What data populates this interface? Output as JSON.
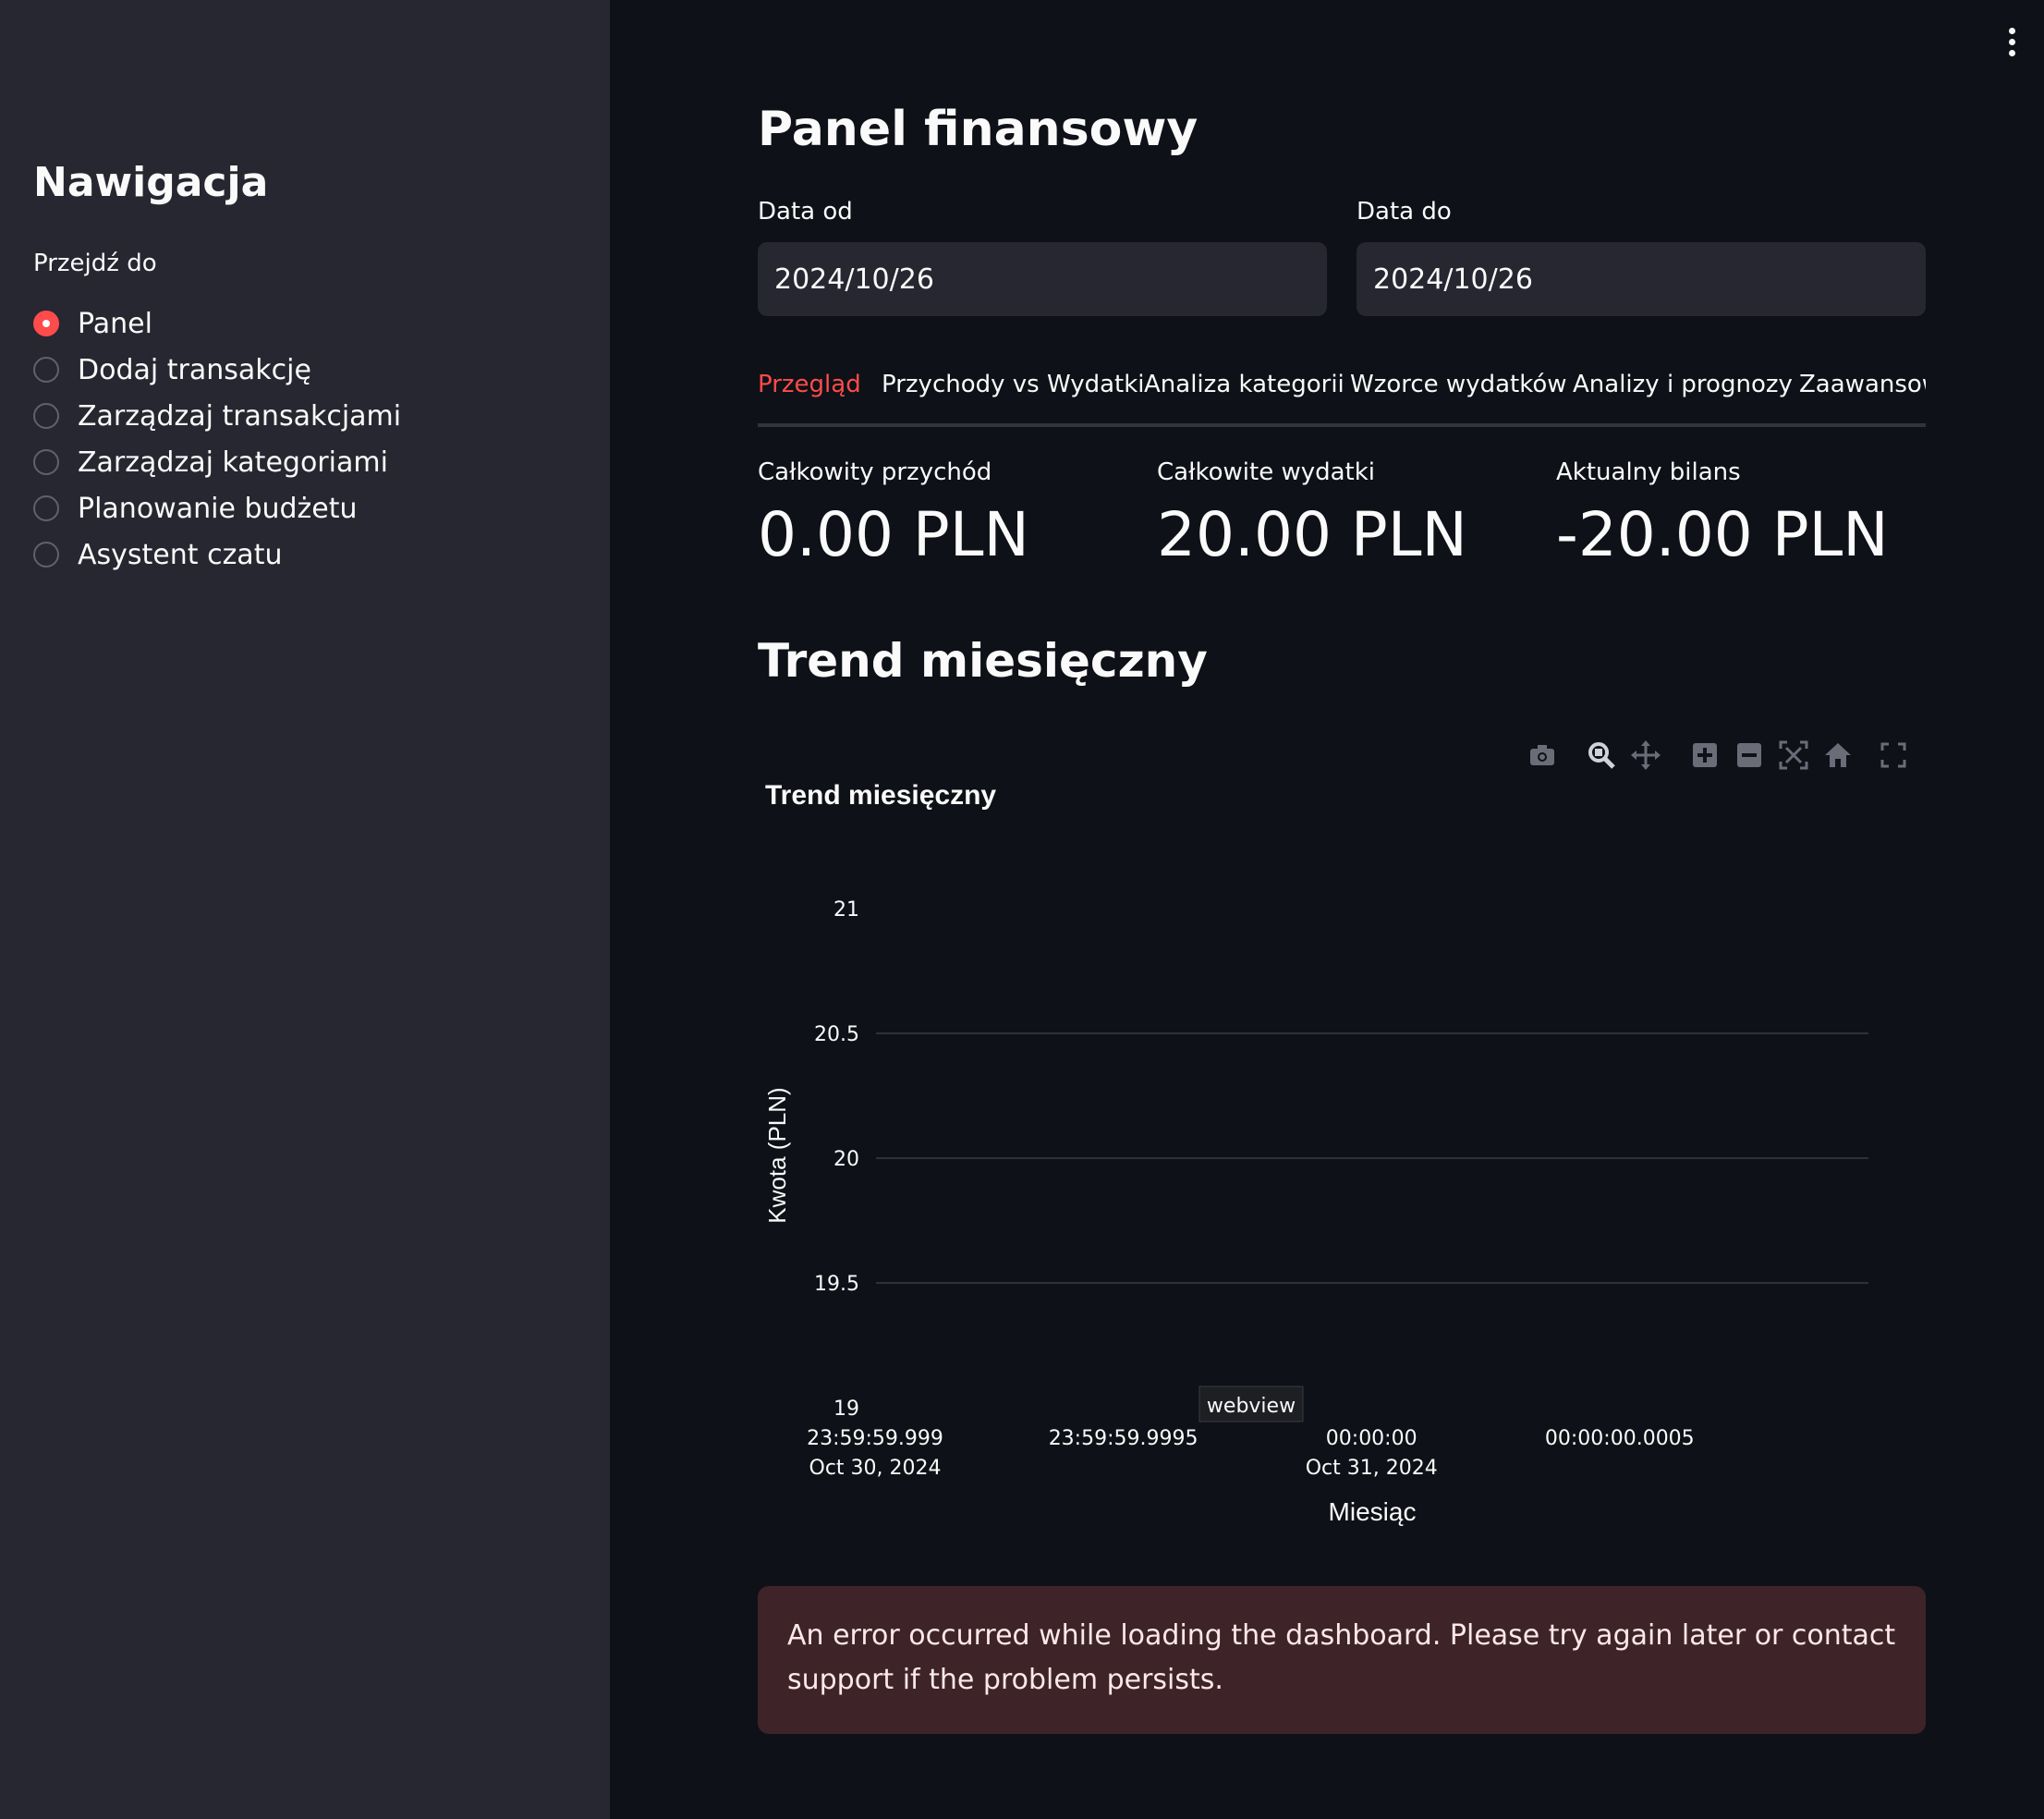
{
  "sidebar": {
    "title": "Nawigacja",
    "radio_label": "Przejdź do",
    "items": [
      {
        "label": "Panel",
        "checked": true
      },
      {
        "label": "Dodaj transakcję",
        "checked": false
      },
      {
        "label": "Zarządzaj transakcjami",
        "checked": false
      },
      {
        "label": "Zarządzaj kategoriami",
        "checked": false
      },
      {
        "label": "Planowanie budżetu",
        "checked": false
      },
      {
        "label": "Asystent czatu",
        "checked": false
      }
    ]
  },
  "main": {
    "title": "Panel finansowy",
    "date_from": {
      "label": "Data od",
      "value": "2024/10/26"
    },
    "date_to": {
      "label": "Data do",
      "value": "2024/10/26"
    },
    "tabs": [
      "Przegląd",
      "Przychody vs Wydatki",
      "Analiza kategorii",
      "Wzorce wydatków",
      "Analizy i prognozy",
      "Zaawansow"
    ],
    "active_tab": 0,
    "metrics": [
      {
        "label": "Całkowity przychód",
        "value": "0.00 PLN"
      },
      {
        "label": "Całkowite wydatki",
        "value": "20.00 PLN"
      },
      {
        "label": "Aktualny bilans",
        "value": "-20.00 PLN"
      }
    ],
    "section_title": "Trend miesięczny",
    "error_message": "An error occurred while loading the dashboard. Please try again later or contact support if the problem persists."
  },
  "modebar_icons": [
    "camera-icon",
    "zoom-icon",
    "pan-icon",
    "zoom-in-icon",
    "zoom-out-icon",
    "autoscale-icon",
    "reset-axes-icon",
    "fullscreen-icon"
  ],
  "tooltip": "webview",
  "colors": {
    "accent": "#ff4b4b",
    "background": "#0e1117",
    "sidebar": "#262730",
    "error_bg": "#3e2428"
  },
  "chart_data": {
    "type": "line",
    "title": "Trend miesięczny",
    "xlabel": "Miesiąc",
    "ylabel": "Kwota (PLN)",
    "ylim": [
      19,
      21
    ],
    "y_ticks": [
      "21",
      "20.5",
      "20",
      "19.5",
      "19"
    ],
    "y_tick_values": [
      21,
      20.5,
      20,
      19.5,
      19
    ],
    "x_ticks": [
      [
        "23:59:59.999",
        "Oct 30, 2024"
      ],
      [
        "23:59:59.9995",
        ""
      ],
      [
        "00:00:00",
        "Oct 31, 2024"
      ],
      [
        "00:00:00.0005",
        ""
      ]
    ],
    "grid": true,
    "series": []
  }
}
